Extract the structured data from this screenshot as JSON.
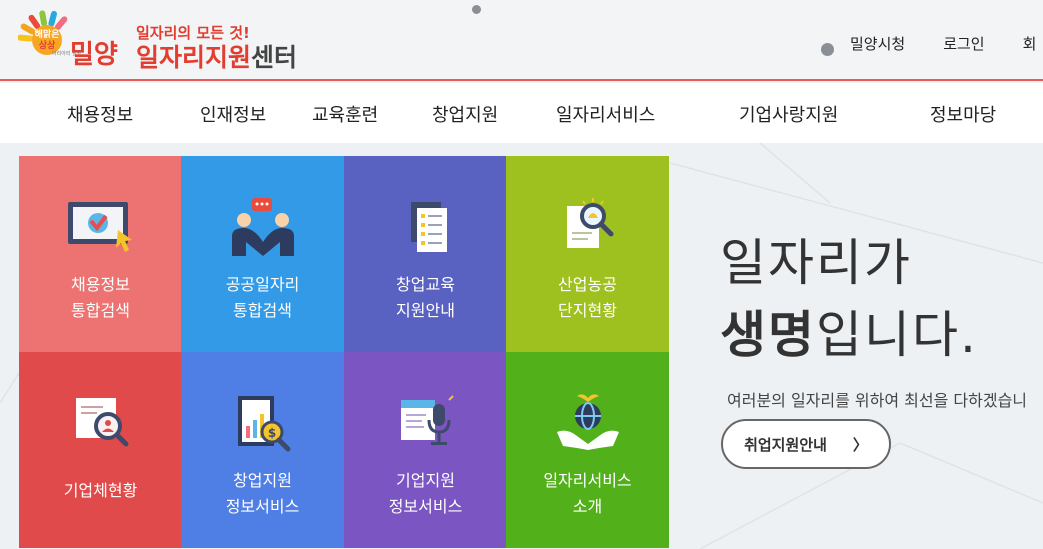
{
  "logo": {
    "badge_top": "해맑은",
    "badge_bottom": "상상",
    "city": "밀양",
    "tagline": "일자리의 모든 것!",
    "center_red": "일자리지원",
    "center_dark": "센터",
    "mini": "아리아리 밀양"
  },
  "util_links": [
    "밀양시청",
    "로그인",
    "회"
  ],
  "nav": [
    "채용정보",
    "인재정보",
    "교육훈련",
    "창업지원",
    "일자리서비스",
    "기업사랑지원",
    "정보마당"
  ],
  "tiles": [
    {
      "label": "채용정보\n통합검색",
      "color": "#ec7372",
      "icon": "monitor-cursor-icon"
    },
    {
      "label": "공공일자리\n통합검색",
      "color": "#329ae6",
      "icon": "people-chat-icon"
    },
    {
      "label": "창업교육\n지원안내",
      "color": "#5962c0",
      "icon": "notebook-icon"
    },
    {
      "label": "산업농공\n단지현황",
      "color": "#9fc11f",
      "icon": "document-magnifier-icon"
    },
    {
      "label": "기업체현황",
      "color": "#e04a4a",
      "icon": "profile-search-icon"
    },
    {
      "label": "창업지원\n정보서비스",
      "color": "#4f7fe5",
      "icon": "chart-coin-icon"
    },
    {
      "label": "기업지원\n정보서비스",
      "color": "#7b55c1",
      "icon": "document-mic-icon"
    },
    {
      "label": "일자리서비스\n소개",
      "color": "#52b01b",
      "icon": "globe-hands-icon"
    }
  ],
  "hero": {
    "line1": "일자리가",
    "line2_bold": "생명",
    "line2_rest": "입니다.",
    "sub": "여러분의 일자리를 위하여 최선을 다하겠습니",
    "button": "취업지원안내",
    "button_arrow": "〉"
  },
  "colors": {
    "accent": "#e23d2f",
    "header_line": "#e35b5b"
  }
}
